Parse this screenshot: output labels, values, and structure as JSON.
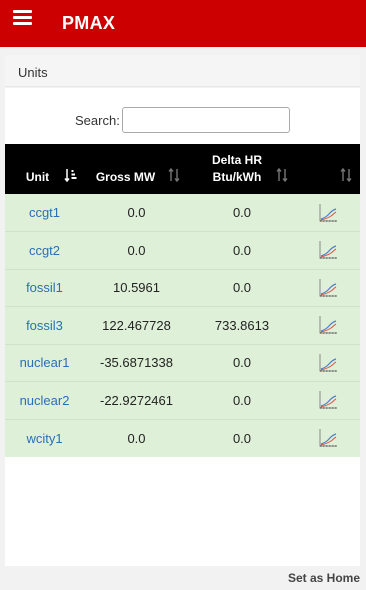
{
  "app": {
    "title": "PMAX"
  },
  "breadcrumb": "Units",
  "search": {
    "label": "Search:",
    "value": "",
    "placeholder": ""
  },
  "table": {
    "headers": {
      "unit": "Unit",
      "gross_mw": "Gross MW",
      "delta_hr_line1": "Delta HR",
      "delta_hr_line2": "Btu/kWh"
    },
    "rows": [
      {
        "unit": "ccgt1",
        "gross_mw": "0.0",
        "delta_hr": "0.0"
      },
      {
        "unit": "ccgt2",
        "gross_mw": "0.0",
        "delta_hr": "0.0"
      },
      {
        "unit": "fossil1",
        "gross_mw": "10.5961",
        "delta_hr": "0.0"
      },
      {
        "unit": "fossil3",
        "gross_mw": "122.467728",
        "delta_hr": "733.8613"
      },
      {
        "unit": "nuclear1",
        "gross_mw": "-35.6871338",
        "delta_hr": "0.0"
      },
      {
        "unit": "nuclear2",
        "gross_mw": "-22.9272461",
        "delta_hr": "0.0"
      },
      {
        "unit": "wcity1",
        "gross_mw": "0.0",
        "delta_hr": "0.0"
      }
    ]
  },
  "footer": {
    "set_home": "Set as Home"
  },
  "colors": {
    "header_bar": "#cc0000",
    "row_bg": "#dff0d8",
    "link": "#2a6fb5",
    "table_header": "#000000"
  }
}
